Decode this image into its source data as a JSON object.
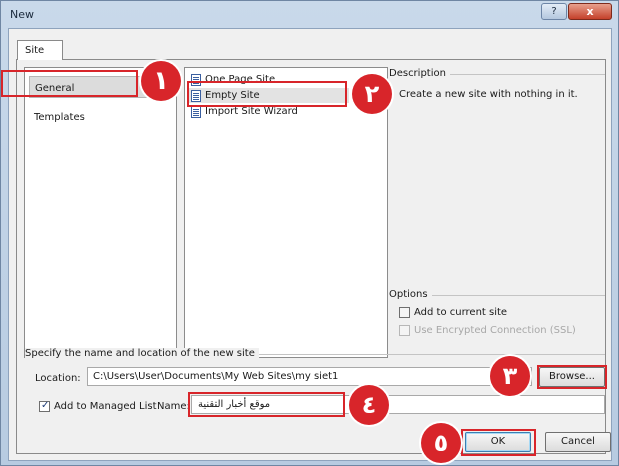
{
  "window": {
    "title": "New",
    "help_label": "?",
    "close_label": "x"
  },
  "tabs": [
    {
      "label": "Site"
    }
  ],
  "categories": [
    {
      "label": "General"
    },
    {
      "label": "Templates"
    }
  ],
  "site_types": [
    {
      "label": "One Page Site"
    },
    {
      "label": "Empty Site"
    },
    {
      "label": "Import Site Wizard"
    }
  ],
  "description": {
    "heading": "Description",
    "text": "Create a new site with nothing in it."
  },
  "options": {
    "heading": "Options",
    "add_to_current_site": "Add to current site",
    "use_encrypted_connection": "Use Encrypted Connection (SSL)"
  },
  "location_section": {
    "heading": "Specify the name and location of the new site",
    "location_label": "Location:",
    "location_value": "C:\\Users\\User\\Documents\\My Web Sites\\my siet1",
    "browse_label": "Browse...",
    "add_to_managed_list": "Add to Managed List",
    "name_label": "Name:",
    "name_value": "موقع أخبار التقنية"
  },
  "buttons": {
    "ok": "OK",
    "cancel": "Cancel"
  },
  "annotations": [
    "١",
    "٢",
    "٣",
    "٤",
    "٥"
  ],
  "colors": {
    "annotation_red": "#d8252a",
    "title_bar": "#c9d9ea",
    "close_button": "#c4402a"
  }
}
